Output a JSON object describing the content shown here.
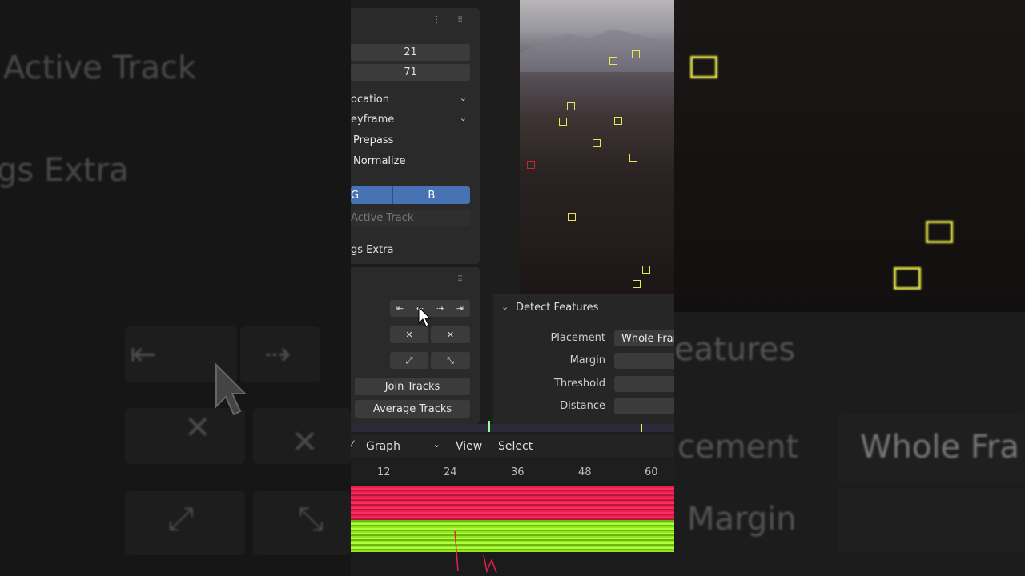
{
  "background_left": {
    "ghost_active_track": "Active Track",
    "ghost_settings_extra": "gs Extra"
  },
  "background_right": {
    "ghost_features": "eatures",
    "ghost_placement": "cement",
    "ghost_whole": "Whole Fra",
    "ghost_margin": "Margin"
  },
  "settings_panel": {
    "field1_value": "21",
    "field2_value": "71",
    "dropdown_motion": "ocation",
    "dropdown_match": "eyframe",
    "prepass_label": "Prepass",
    "normalize_label": "Normalize",
    "channel_g": "G",
    "channel_b": "B",
    "active_track_label": "Active Track",
    "settings_extra_label": "gs Extra"
  },
  "track_panel": {
    "join_tracks_label": "Join Tracks",
    "average_tracks_label": "Average Tracks"
  },
  "detect_features": {
    "title": "Detect Features",
    "placement_label": "Placement",
    "placement_value": "Whole Frame",
    "margin_label": "Margin",
    "threshold_label": "Threshold",
    "distance_label": "Distance"
  },
  "graph_header": {
    "mode_label": "Graph",
    "view_label": "View",
    "select_label": "Select",
    "ruler_ticks": [
      "12",
      "24",
      "36",
      "48",
      "60"
    ]
  },
  "colors": {
    "accent_blue": "#4772b3",
    "marker_yellow": "#e8e84a",
    "curve_red": "#e8204e",
    "curve_green": "#8fe91e"
  }
}
